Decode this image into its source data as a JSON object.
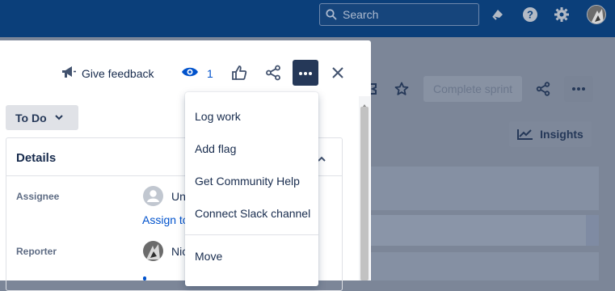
{
  "topbar": {
    "search_placeholder": "Search",
    "icons": [
      "search-icon",
      "notifications-icon",
      "help-icon",
      "settings-icon",
      "profile-avatar"
    ]
  },
  "board": {
    "complete_sprint_label": "Complete sprint",
    "insights_label": "Insights"
  },
  "issue_panel": {
    "feedback_label": "Give feedback",
    "watch_count": "1",
    "status_label": "To Do",
    "details": {
      "title": "Details",
      "assignee_label": "Assignee",
      "assignee_value": "Un",
      "assign_link": "Assign to",
      "reporter_label": "Reporter",
      "reporter_value": "Nic"
    }
  },
  "more_menu": {
    "items": [
      "Log work",
      "Add flag",
      "Get Community Help",
      "Connect Slack channel",
      "Move"
    ]
  },
  "colors": {
    "topbar": "#0b3f7a",
    "overlay": "#7c8698",
    "more_button": "#253858",
    "link": "#0052cc"
  }
}
